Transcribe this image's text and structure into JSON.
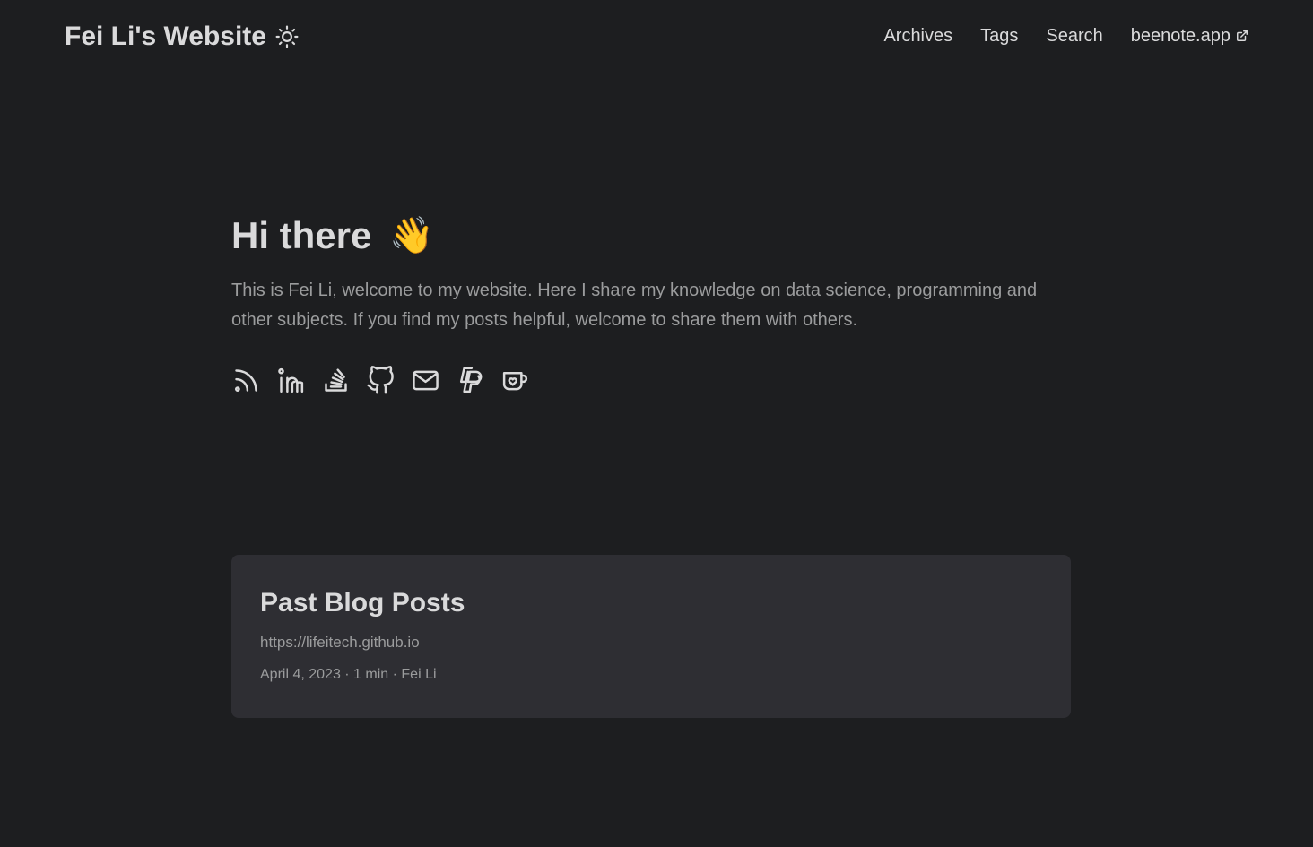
{
  "site": {
    "title": "Fei Li's Website",
    "theme_toggle_icon": "sun-icon"
  },
  "menu": {
    "items": [
      {
        "label": "Archives"
      },
      {
        "label": "Tags"
      },
      {
        "label": "Search"
      },
      {
        "label": "beenote.app",
        "icon": "external-link-icon"
      }
    ]
  },
  "hero": {
    "title": "Hi there",
    "emoji": "👋",
    "description": "This is Fei Li, welcome to my website. Here I share my knowledge on data science, programming and other subjects. If you find my posts helpful, welcome to share them with others."
  },
  "social_icons": [
    "rss-icon",
    "linkedin-icon",
    "stackoverflow-icon",
    "github-icon",
    "email-icon",
    "paypal-icon",
    "kofi-icon"
  ],
  "post_card": {
    "title": "Past Blog Posts",
    "url": "https://lifeitech.github.io",
    "meta": "April 4, 2023 · 1 min · Fei Li"
  },
  "colors": {
    "background": "#1d1e20",
    "card": "#2e2e33",
    "primary_text": "#dadadb",
    "secondary_text": "#9b9c9d"
  }
}
